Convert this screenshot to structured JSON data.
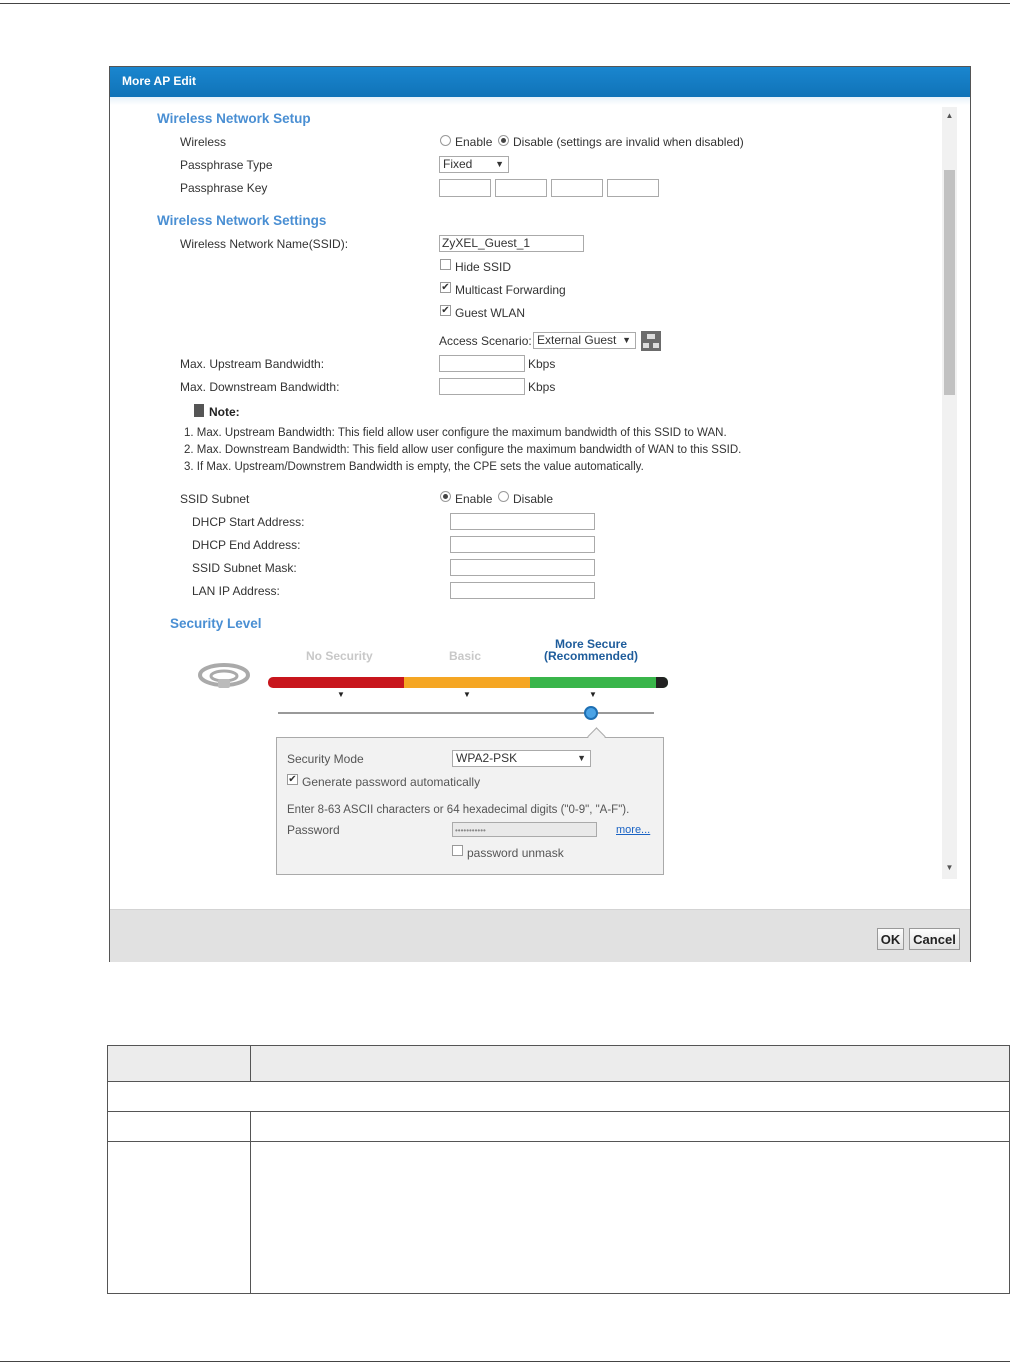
{
  "dialog": {
    "title": "More AP Edit",
    "ok_label": "OK",
    "cancel_label": "Cancel"
  },
  "setup": {
    "title": "Wireless Network Setup",
    "wireless_label": "Wireless",
    "enable_label": "Enable",
    "disable_label": "Disable (settings are invalid when disabled)",
    "wireless_value": "Disable",
    "passphrase_type_label": "Passphrase Type",
    "passphrase_type_value": "Fixed",
    "passphrase_key_label": "Passphrase Key"
  },
  "settings": {
    "title": "Wireless Network Settings",
    "ssid_label": "Wireless Network Name(SSID):",
    "ssid_value": "ZyXEL_Guest_1",
    "hide_ssid_label": "Hide SSID",
    "hide_ssid_checked": false,
    "multicast_label": "Multicast Forwarding",
    "multicast_checked": true,
    "guest_wlan_label": "Guest WLAN",
    "guest_wlan_checked": true,
    "access_scenario_label": "Access Scenario:",
    "access_scenario_value": "External Guest",
    "upstream_label": "Max. Upstream Bandwidth:",
    "downstream_label": "Max. Downstream Bandwidth:",
    "kbps_unit": "Kbps"
  },
  "note": {
    "title": "Note:",
    "lines": [
      "1. Max. Upstream Bandwidth: This field allow user configure the maximum bandwidth of this SSID to WAN.",
      "2. Max. Downstream Bandwidth: This field allow user configure the maximum bandwidth of WAN to this SSID.",
      "3. If Max. Upstream/Downstrem Bandwidth is empty, the CPE sets the value automatically."
    ]
  },
  "subnet": {
    "label": "SSID Subnet",
    "enable_label": "Enable",
    "disable_label": "Disable",
    "value": "Enable",
    "dhcp_start_label": "DHCP Start Address:",
    "dhcp_end_label": "DHCP End Address:",
    "mask_label": "SSID Subnet Mask:",
    "lan_ip_label": "LAN IP Address:"
  },
  "security": {
    "title": "Security Level",
    "levels": [
      "No Security",
      "Basic",
      "More Secure\n(Recommended)"
    ],
    "level_no_security": "No Security",
    "level_basic": "Basic",
    "level_more_secure_1": "More Secure",
    "level_more_secure_2": "(Recommended)",
    "selected_level_index": 2,
    "mode_label": "Security Mode",
    "mode_value": "WPA2-PSK",
    "generate_label": "Generate password automatically",
    "generate_checked": true,
    "hint": "Enter 8-63 ASCII characters or 64 hexadecimal digits (\"0-9\", \"A-F\").",
    "password_label": "Password",
    "password_value": "•••••••••••",
    "more_link": "more...",
    "unmask_label": "password unmask",
    "unmask_checked": false
  },
  "colors": {
    "titlebar": "#0e6fb3",
    "section_title": "#4a8fd3",
    "bar_red": "#c8161d",
    "bar_orange": "#f5a623",
    "bar_green": "#39b54a"
  }
}
